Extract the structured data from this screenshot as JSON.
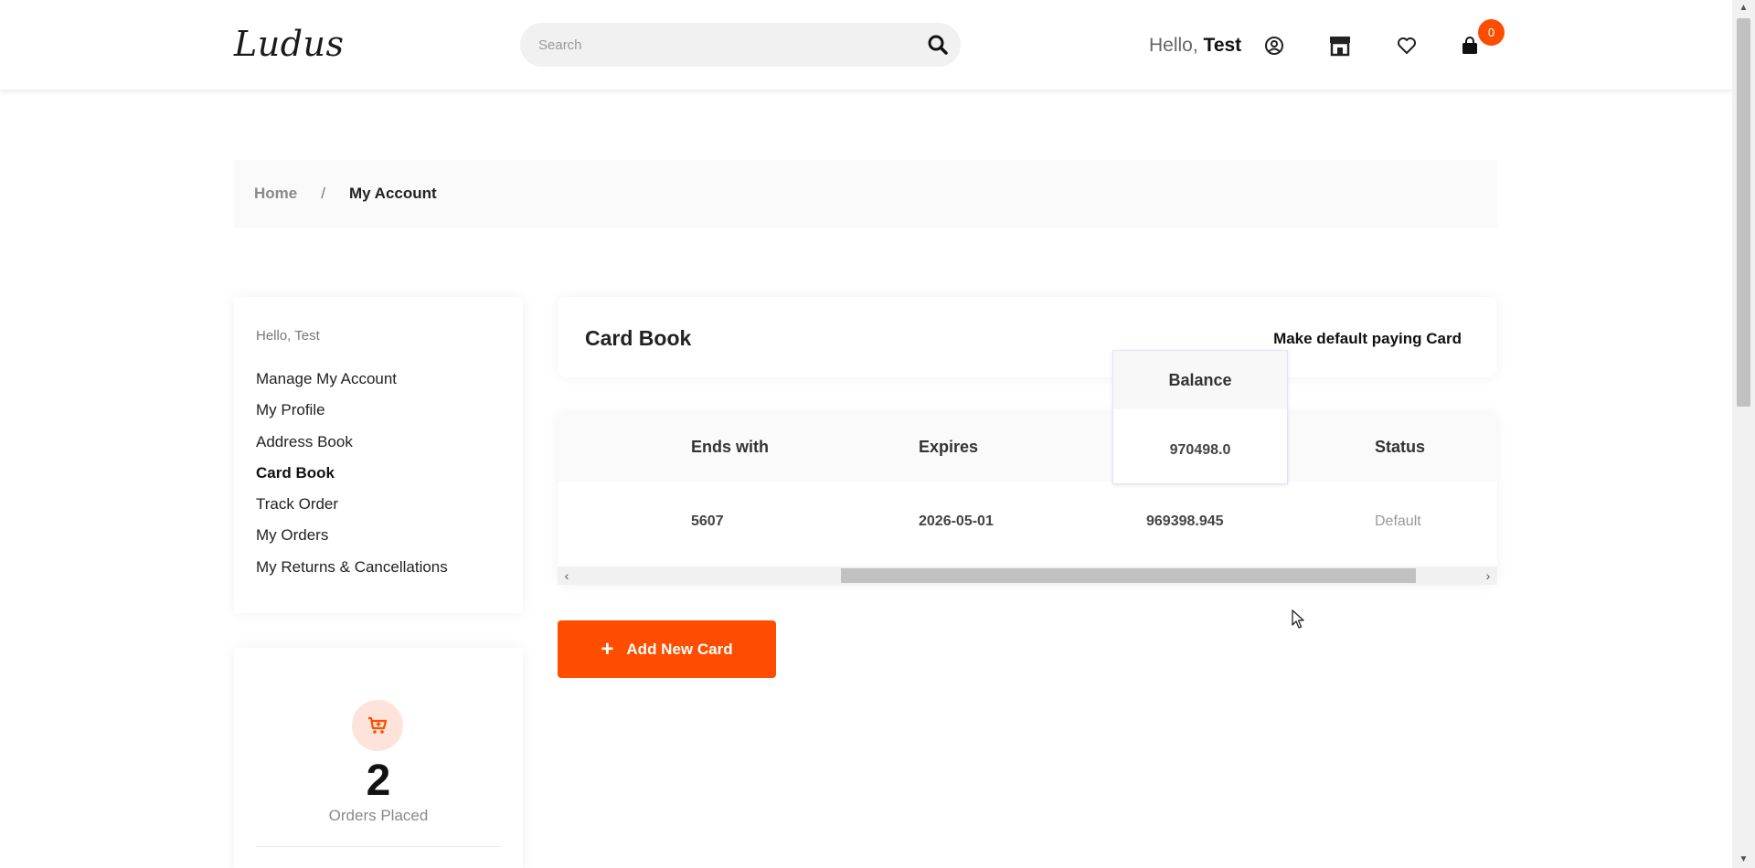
{
  "header": {
    "logo": "Ludus",
    "search_placeholder": "Search",
    "hello_prefix": "Hello,",
    "hello_name": "Test",
    "cart_count": "0",
    "icons": [
      "search-icon",
      "user-icon",
      "store-icon",
      "heart-icon",
      "shopping-bag-icon"
    ]
  },
  "breadcrumb": {
    "home": "Home",
    "separator": "/",
    "current": "My Account"
  },
  "sidebar": {
    "greeting": "Hello, Test",
    "items": [
      {
        "label": "Manage My Account"
      },
      {
        "label": "My Profile"
      },
      {
        "label": "Address Book"
      },
      {
        "label": "Card Book"
      },
      {
        "label": "Track Order"
      },
      {
        "label": "My Orders"
      },
      {
        "label": "My Returns & Cancellations"
      }
    ]
  },
  "stats": {
    "orders_count": "2",
    "orders_label": "Orders Placed"
  },
  "card_book": {
    "title": "Card Book",
    "default_action": "Make default paying Card",
    "columns": [
      "Ends with",
      "Expires",
      "Balance",
      "Status"
    ],
    "rows": [
      {
        "ends_with": "5607",
        "expires": "2026-05-01",
        "balance": "969398.945",
        "status": "Default"
      }
    ],
    "tooltip": {
      "header": "Balance",
      "value": "970498.0"
    },
    "add_button": "Add New Card"
  },
  "colors": {
    "accent": "#ff4d00",
    "icon_bg": "#fde3d9"
  }
}
